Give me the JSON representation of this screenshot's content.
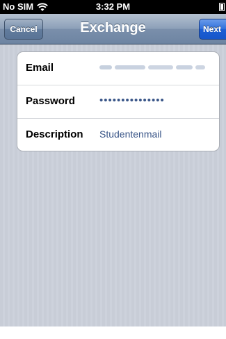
{
  "status_bar": {
    "carrier": "No SIM",
    "time": "3:32 PM",
    "wifi_icon": "wifi-icon",
    "battery_icon": "battery-icon"
  },
  "nav": {
    "title": "Exchange",
    "cancel_label": "Cancel",
    "next_label": "Next"
  },
  "form": {
    "fields": [
      {
        "label": "Email",
        "value": "",
        "value_obscured": true
      },
      {
        "label": "Password",
        "value": "•••••••••••••••"
      },
      {
        "label": "Description",
        "value": "Studentenmail"
      }
    ]
  },
  "colors": {
    "nav_bar": "#7a8fab",
    "next_button": "#1c5ed4",
    "value_text": "#385487",
    "background": "#c7ccd6"
  }
}
